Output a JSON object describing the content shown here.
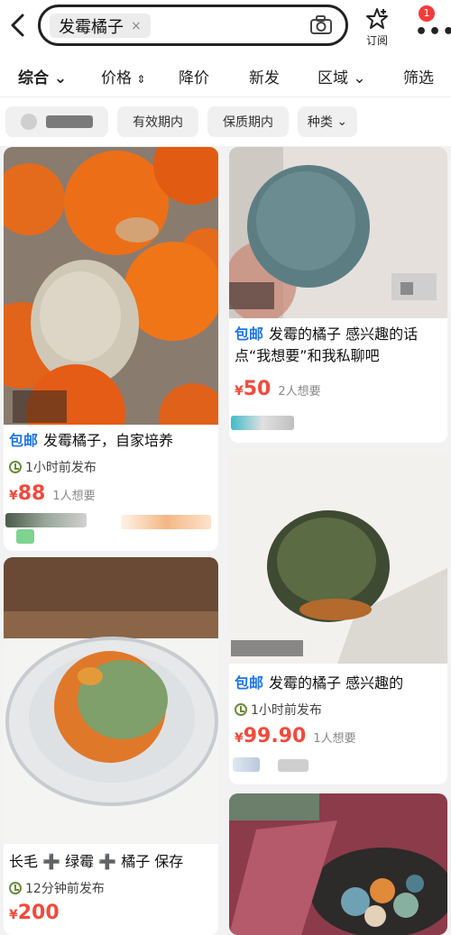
{
  "search": {
    "query": "发霉橘子",
    "clear": "×"
  },
  "header": {
    "subscribe_label": "订阅",
    "notification_count": "1"
  },
  "filters": [
    "综合",
    "价格",
    "降价",
    "新发",
    "区域",
    "筛选"
  ],
  "tags": [
    "有效期内",
    "保质期内",
    "种类"
  ],
  "cards": [
    {
      "badge": "包邮",
      "title": "发霉橘子，自家培养",
      "time": "1小时前发布",
      "price": "88",
      "wants": "1人想要"
    },
    {
      "badge": "包邮",
      "title": "发霉的橘子 感兴趣的话点“我想要”和我私聊吧",
      "time": "",
      "price": "50",
      "wants": "2人想要"
    },
    {
      "badge": "包邮",
      "title": "发霉的橘子 感兴趣的",
      "time": "1小时前发布",
      "price": "99.90",
      "wants": "1人想要"
    },
    {
      "badge": "",
      "title": "长毛 ➕ 绿霉 ➕ 橘子 保存",
      "time": "12分钟前发布",
      "price": "200",
      "wants": ""
    }
  ],
  "currency": "¥",
  "colors": {
    "price": "#f24a3c",
    "badge_blue": "#1e74e8",
    "notify_red": "#f23c3c"
  }
}
